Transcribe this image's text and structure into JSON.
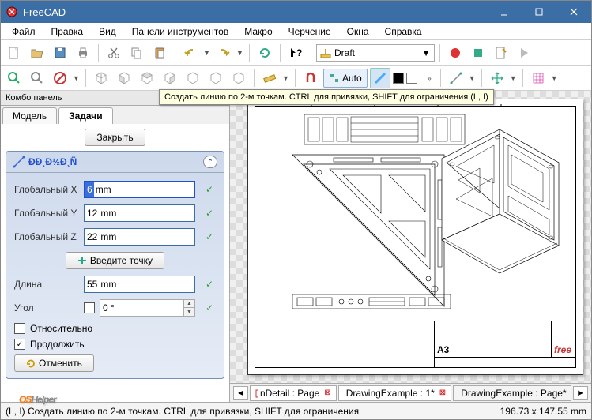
{
  "app": {
    "title": "FreeCAD"
  },
  "menu": [
    "Файл",
    "Правка",
    "Вид",
    "Панели инструментов",
    "Макро",
    "Черчение",
    "Окна",
    "Справка"
  ],
  "workbench": {
    "label": "Draft"
  },
  "toolbar2": {
    "auto_label": "Auto"
  },
  "tooltip": "Создать линию по 2-м точкам. CTRL для привязки, SHIFT для ограничения (L, I)",
  "combo": {
    "title": "Комбо панель",
    "tabs": {
      "model": "Модель",
      "tasks": "Задачи"
    },
    "close_btn": "Закрыть",
    "task_header": "ÐÐ¸Ð½Ð¸Ñ",
    "global_x_label": "Глобальный X",
    "global_x_val": "6",
    "global_y_label": "Глобальный Y",
    "global_y_val": "12",
    "global_z_label": "Глобальный Z",
    "global_z_val": "22",
    "enter_point_btn": "Введите точку",
    "length_label": "Длина",
    "length_val": "55",
    "angle_label": "Угол",
    "angle_val": "0 °",
    "unit_mm": "mm",
    "relative_label": "Относительно",
    "continue_label": "Продолжить",
    "cancel_btn": "Отменить",
    "check_mark": "✓"
  },
  "bottom_tabs": {
    "t1": "nDetail : Page",
    "t2": "DrawingExample : 1*",
    "t3": "DrawingExample : Page*"
  },
  "title_block": {
    "format": "A3",
    "logo": "free"
  },
  "status": {
    "left": "(L, I) Создать линию по 2-м точкам. CTRL для привязки, SHIFT для ограничения",
    "right": "196.73 x 147.55 mm"
  },
  "watermark": {
    "os": "OS",
    "helper": "Helper"
  }
}
